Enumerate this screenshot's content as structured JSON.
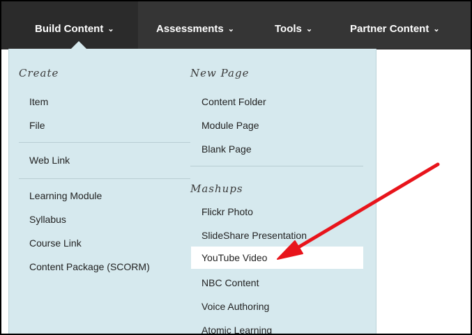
{
  "navbar": {
    "items": [
      {
        "label": "Build Content",
        "caret": "⌄",
        "active": true
      },
      {
        "label": "Assessments",
        "caret": "⌄",
        "active": false
      },
      {
        "label": "Tools",
        "caret": "⌄",
        "active": false
      },
      {
        "label": "Partner Content",
        "caret": "⌄",
        "active": false
      }
    ]
  },
  "menu": {
    "create": {
      "heading": "Create",
      "items": [
        "Item",
        "File",
        "Web Link",
        "Learning Module",
        "Syllabus",
        "Course Link",
        "Content Package (SCORM)"
      ]
    },
    "new_page": {
      "heading": "New Page",
      "items": [
        "Content Folder",
        "Module Page",
        "Blank Page"
      ]
    },
    "mashups": {
      "heading": "Mashups",
      "items": [
        "Flickr Photo",
        "SlideShare Presentation",
        "YouTube Video",
        "NBC Content",
        "Voice Authoring",
        "Atomic Learning"
      ],
      "highlighted_item": "YouTube Video"
    }
  },
  "colors": {
    "navbar": "#353535",
    "menu_background": "#d6e9ee",
    "highlight": "#ffffff",
    "arrow": "#e8141b"
  }
}
